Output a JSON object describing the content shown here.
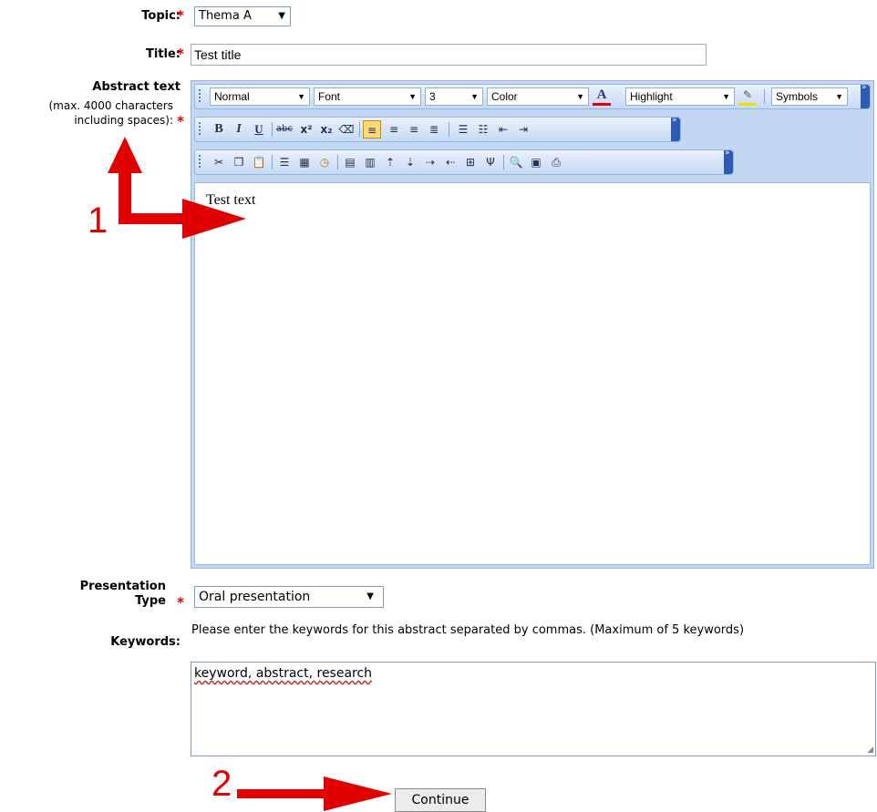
{
  "form": {
    "topic": {
      "label": "Topic:",
      "value": "Thema A"
    },
    "title": {
      "label": "Title:",
      "value": "Test title"
    },
    "abstract": {
      "label": "Abstract text",
      "hint_line1": "(max. 4000 characters",
      "hint_line2": "including spaces):",
      "content": "Test text"
    },
    "presentation_type": {
      "label_line1": "Presentation",
      "label_line2": "Type",
      "value": "Oral presentation"
    },
    "keywords": {
      "label": "Keywords:",
      "help": "Please enter the keywords for this abstract separated by commas. (Maximum of 5 keywords)",
      "value": "keyword, abstract, research"
    },
    "required_mark": "*",
    "continue_label": "Continue"
  },
  "editor_toolbar": {
    "format": "Normal",
    "font": "Font",
    "size": "3",
    "color": "Color",
    "highlight": "Highlight",
    "symbols": "Symbols"
  },
  "annotations": {
    "marker1": "1",
    "marker2": "2"
  },
  "colors": {
    "required": "#d40000",
    "annotation": "#e00000",
    "toolbar": "#c6daf5"
  }
}
